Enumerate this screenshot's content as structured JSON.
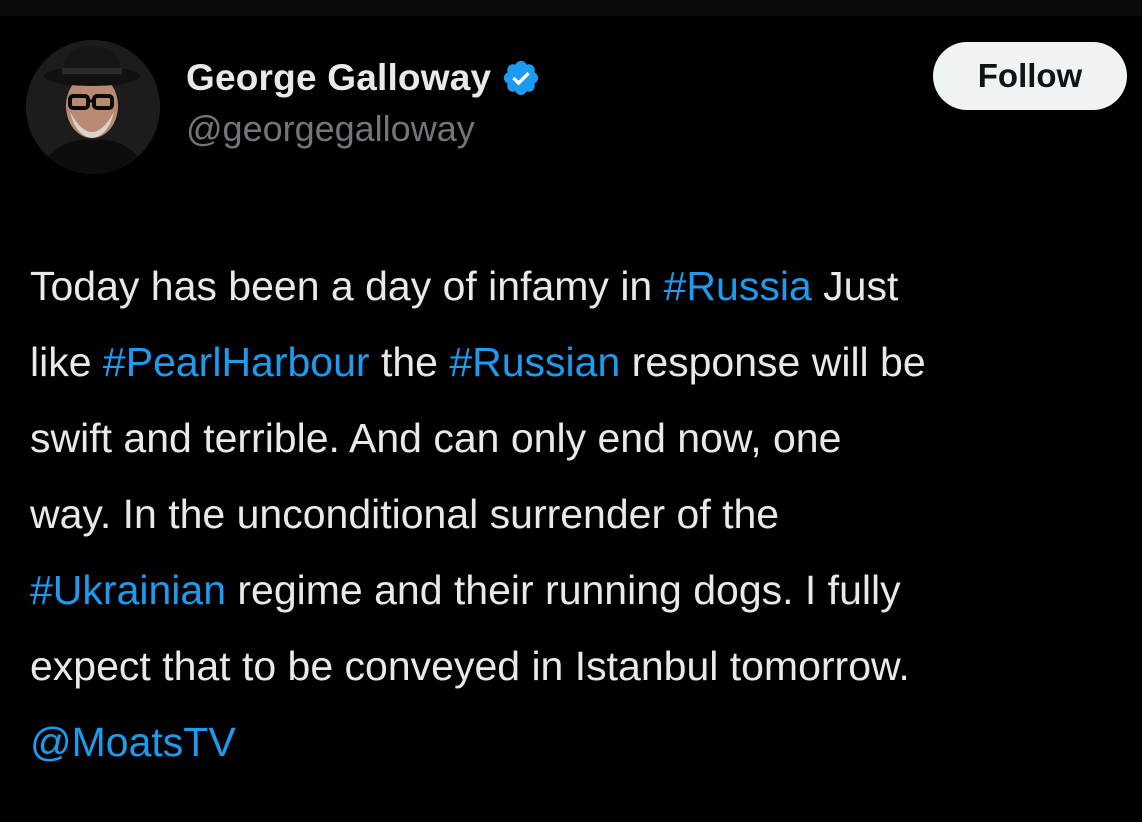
{
  "author": {
    "name": "George Galloway",
    "handle": "@georgegalloway",
    "verified": true,
    "verified_icon": "verified-badge-icon",
    "verified_color": "#1d9bf0"
  },
  "follow_label": "Follow",
  "tweet": {
    "lines": [
      [
        {
          "type": "text",
          "text": "Today has been a day of infamy in "
        },
        {
          "type": "hashtag",
          "text": "#Russia"
        },
        {
          "type": "text",
          "text": " Just"
        }
      ],
      [
        {
          "type": "text",
          "text": "like "
        },
        {
          "type": "hashtag",
          "text": "#PearlHarbour"
        },
        {
          "type": "text",
          "text": " the "
        },
        {
          "type": "hashtag",
          "text": "#Russian"
        },
        {
          "type": "text",
          "text": " response will be"
        }
      ],
      [
        {
          "type": "text",
          "text": "swift and terrible. And can only end now, one"
        }
      ],
      [
        {
          "type": "text",
          "text": "way. In the unconditional surrender of the"
        }
      ],
      [
        {
          "type": "hashtag",
          "text": "#Ukrainian"
        },
        {
          "type": "text",
          "text": " regime and their running dogs. I fully"
        }
      ],
      [
        {
          "type": "text",
          "text": "expect that to be conveyed in Istanbul tomorrow."
        }
      ],
      [
        {
          "type": "mention",
          "text": "@MoatsTV"
        }
      ]
    ]
  },
  "colors": {
    "background": "#000000",
    "text": "#e7e9ea",
    "secondary": "#71767b",
    "link": "#1d9bf0",
    "button_bg": "#eff3f4"
  }
}
